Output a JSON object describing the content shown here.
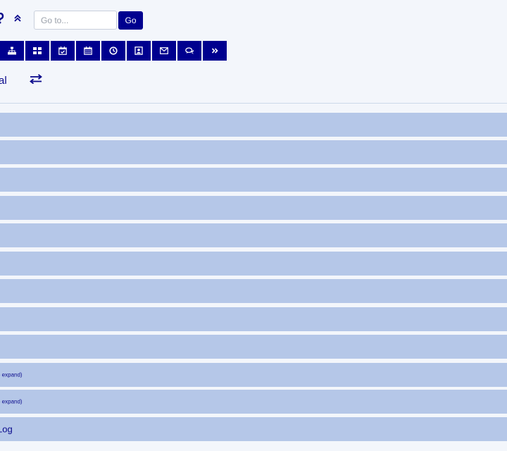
{
  "header": {
    "goto_placeholder": "Go to...",
    "goto_value": "",
    "go_label": "Go"
  },
  "toolbar": {
    "buttons": [
      {
        "icon": "sitemap-icon"
      },
      {
        "icon": "grid-icon"
      },
      {
        "icon": "calendar-check-icon"
      },
      {
        "icon": "calendar-icon"
      },
      {
        "icon": "clock-icon"
      },
      {
        "icon": "contact-card-icon"
      },
      {
        "icon": "envelope-icon"
      },
      {
        "icon": "comments-icon"
      },
      {
        "icon": "double-chevron-right-icon"
      }
    ]
  },
  "title": {
    "fragment": "al"
  },
  "rows": [
    {
      "label": ""
    },
    {
      "label": ""
    },
    {
      "label": ""
    },
    {
      "label": ""
    },
    {
      "label": ""
    },
    {
      "label": ""
    },
    {
      "label": ""
    },
    {
      "label": ""
    },
    {
      "label": ""
    },
    {
      "label": "o expand)"
    },
    {
      "label": "o expand)"
    },
    {
      "label": "Log"
    }
  ],
  "colors": {
    "accent": "#00008f",
    "row_bg": "#b5c7e8",
    "page_bg": "#f3f6fb",
    "text": "#0a0a8c"
  }
}
